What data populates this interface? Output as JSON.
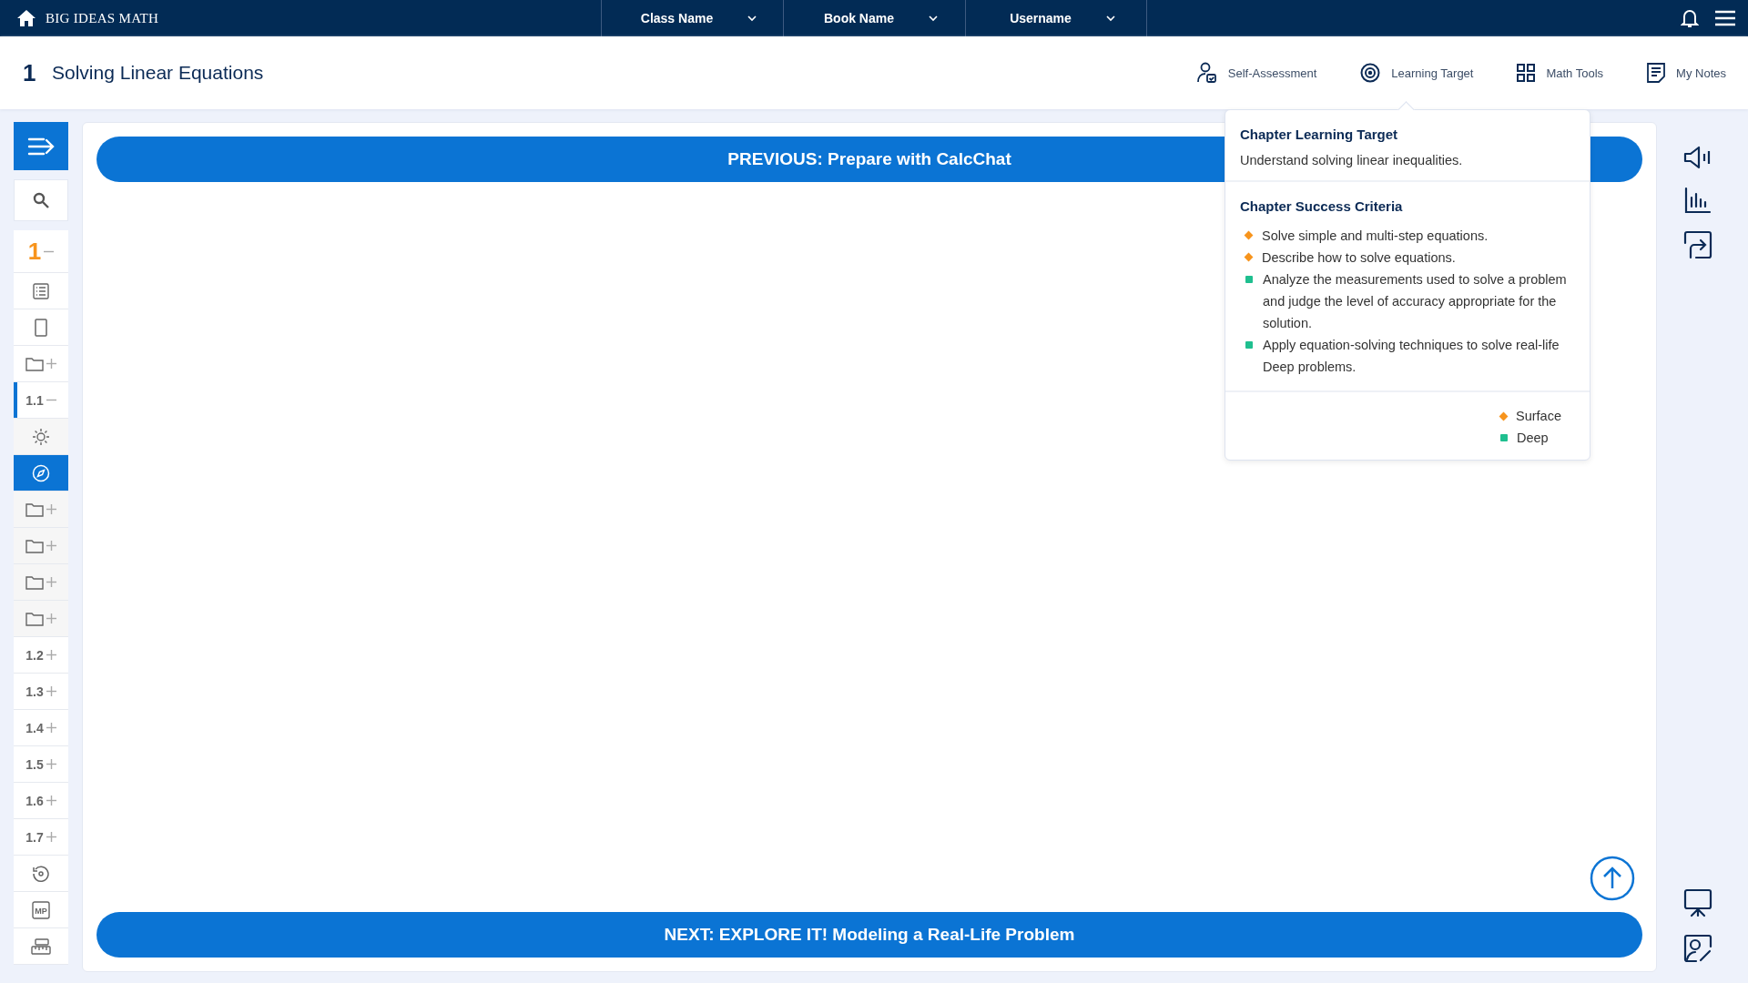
{
  "brand": "BIG IDEAS MATH",
  "dropdowns": [
    {
      "label": "Class Name"
    },
    {
      "label": "Book Name"
    },
    {
      "label": "Username"
    }
  ],
  "chapter": {
    "number": "1",
    "title": "Solving Linear Equations"
  },
  "tools": [
    {
      "kind": "self-assessment",
      "label": "Self-Assessment"
    },
    {
      "kind": "target",
      "label": "Learning Target"
    },
    {
      "kind": "tools",
      "label": "Math Tools"
    },
    {
      "kind": "notes",
      "label": "My Notes"
    }
  ],
  "sidebar": {
    "items": [
      {
        "kind": "chapter",
        "label": "1",
        "expanded": true,
        "selected": false,
        "children": [
          {
            "kind": "list",
            "selected": false
          },
          {
            "kind": "page",
            "selected": false
          },
          {
            "kind": "folder",
            "expanded": false,
            "selected": false
          },
          {
            "kind": "section",
            "label": "1.1",
            "expanded": true,
            "selected": false,
            "current": true,
            "children": [
              {
                "kind": "sun",
                "selected": false
              },
              {
                "kind": "compass",
                "selected": true
              },
              {
                "kind": "folder",
                "expanded": false,
                "selected": false
              },
              {
                "kind": "folder",
                "expanded": false,
                "selected": false
              },
              {
                "kind": "folder",
                "expanded": false,
                "selected": false
              },
              {
                "kind": "folder",
                "expanded": false,
                "selected": false
              }
            ]
          },
          {
            "kind": "section",
            "label": "1.2",
            "expanded": false,
            "selected": false,
            "current": false
          },
          {
            "kind": "section",
            "label": "1.3",
            "expanded": false,
            "selected": false,
            "current": false
          },
          {
            "kind": "section",
            "label": "1.4",
            "expanded": false,
            "selected": false,
            "current": false
          },
          {
            "kind": "section",
            "label": "1.5",
            "expanded": false,
            "selected": false,
            "current": false
          },
          {
            "kind": "section",
            "label": "1.6",
            "expanded": false,
            "selected": false,
            "current": false
          },
          {
            "kind": "section",
            "label": "1.7",
            "expanded": false,
            "selected": false,
            "current": false
          }
        ]
      },
      {
        "kind": "review",
        "selected": false
      },
      {
        "kind": "badge",
        "label": "MP",
        "selected": false
      },
      {
        "kind": "ruler",
        "selected": false
      }
    ]
  },
  "previous_button": "PREVIOUS: Prepare with CalcChat",
  "next_button": "NEXT: EXPLORE IT! Modeling a Real-Life Problem",
  "popup": {
    "target_heading": "Chapter Learning Target",
    "target_text": "Understand solving linear inequalities.",
    "criteria_heading": "Chapter Success Criteria",
    "criteria": [
      {
        "text": "Solve simple and multi-step equations.",
        "kind": "diamond",
        "color": "#f7941d"
      },
      {
        "text": "Describe how to solve equations.",
        "kind": "diamond",
        "color": "#f7941d"
      },
      {
        "text": "Analyze the measurements used to solve a problem and judge the level of accuracy appropriate for the solution.",
        "kind": "square",
        "color": "#1fbf8f"
      },
      {
        "text": "Apply equation-solving techniques to solve real-life Deep problems.",
        "kind": "square",
        "color": "#1fbf8f"
      }
    ],
    "legend": [
      {
        "text": "Surface",
        "kind": "diamond",
        "color": "#f7941d"
      },
      {
        "text": "Deep",
        "kind": "square",
        "color": "#1fbf8f"
      }
    ]
  }
}
